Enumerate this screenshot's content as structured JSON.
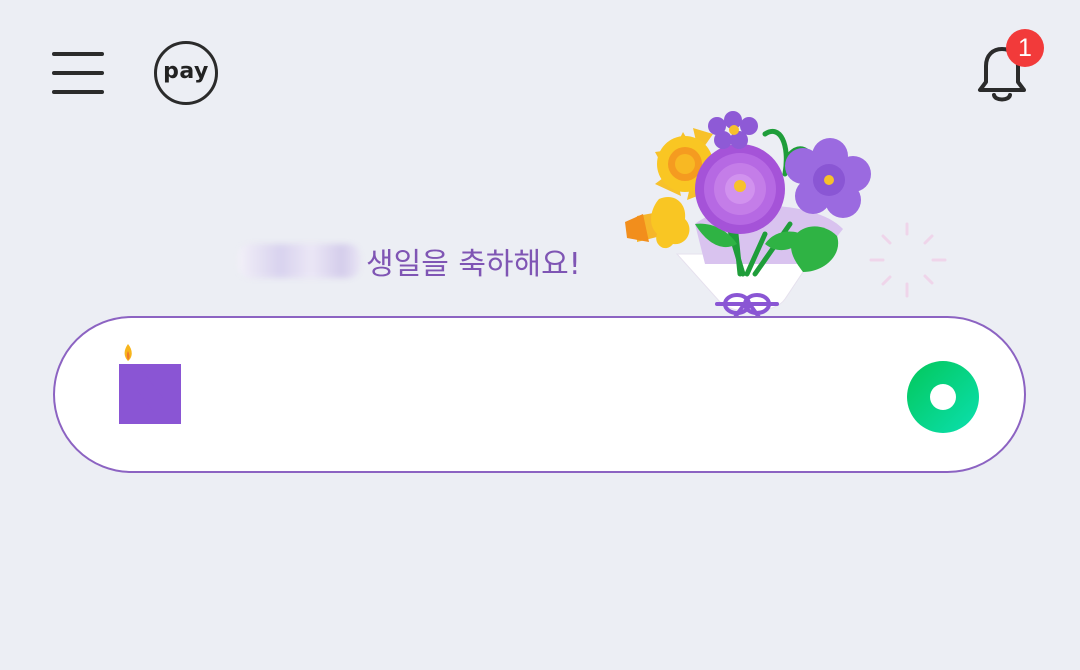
{
  "header": {
    "menu_icon": "hamburger-menu-icon",
    "pay_label": "pay",
    "notification_icon": "bell-icon",
    "notification_count": "1"
  },
  "greeting": {
    "name_redacted": true,
    "text": "생일을 축하해요!"
  },
  "doodle": {
    "icon": "birthday-bouquet-illustration"
  },
  "search": {
    "logo_icon": "naver-n-birthday-candle-icon",
    "value": "",
    "placeholder": "",
    "action_icon": "green-circle-icon"
  },
  "colors": {
    "background": "#eceef4",
    "accent_purple": "#8c63c2",
    "greeting_text": "#7f55b4",
    "badge_red": "#f23a3a",
    "naver_green": "#03d67a"
  }
}
